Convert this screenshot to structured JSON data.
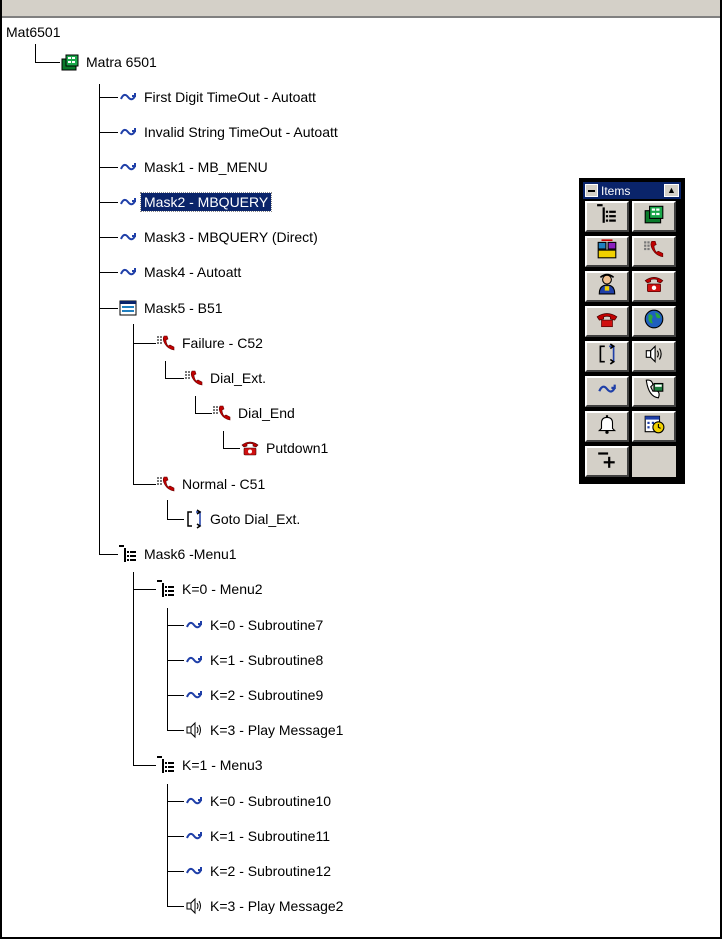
{
  "tree": {
    "root_label": "Mat6501",
    "nodes": [
      {
        "label": "Matra 6501",
        "icon": "matra-switch-icon"
      },
      {
        "label": "First Digit TimeOut - Autoatt",
        "icon": "subroutine-arrow-icon"
      },
      {
        "label": "Invalid String TimeOut - Autoatt",
        "icon": "subroutine-arrow-icon"
      },
      {
        "label": "Mask1 - MB_MENU",
        "icon": "subroutine-arrow-icon"
      },
      {
        "label": "Mask2 - MBQUERY",
        "icon": "subroutine-arrow-icon",
        "selected": true
      },
      {
        "label": "Mask3 - MBQUERY (Direct)",
        "icon": "subroutine-arrow-icon"
      },
      {
        "label": "Mask4 - Autoatt",
        "icon": "subroutine-arrow-icon"
      },
      {
        "label": "Mask5 - B51",
        "icon": "form-window-icon"
      },
      {
        "label": "Failure - C52",
        "icon": "dial-phone-icon"
      },
      {
        "label": "Dial_Ext.",
        "icon": "dial-phone-icon"
      },
      {
        "label": "Dial_End",
        "icon": "dial-phone-icon"
      },
      {
        "label": "Putdown1",
        "icon": "red-telephone-icon"
      },
      {
        "label": "Normal - C51",
        "icon": "dial-phone-icon"
      },
      {
        "label": "Goto Dial_Ext.",
        "icon": "goto-bracket-icon"
      },
      {
        "label": "Mask6 -Menu1",
        "icon": "menu-tree-icon"
      },
      {
        "label": "K=0 - Menu2",
        "icon": "menu-tree-icon"
      },
      {
        "label": "K=0 - Subroutine7",
        "icon": "subroutine-arrow-icon"
      },
      {
        "label": "K=1 - Subroutine8",
        "icon": "subroutine-arrow-icon"
      },
      {
        "label": "K=2 - Subroutine9",
        "icon": "subroutine-arrow-icon"
      },
      {
        "label": "K=3 - Play Message1",
        "icon": "speaker-icon"
      },
      {
        "label": "K=1 - Menu3",
        "icon": "menu-tree-icon"
      },
      {
        "label": "K=0 - Subroutine10",
        "icon": "subroutine-arrow-icon"
      },
      {
        "label": "K=1 - Subroutine11",
        "icon": "subroutine-arrow-icon"
      },
      {
        "label": "K=2 - Subroutine12",
        "icon": "subroutine-arrow-icon"
      },
      {
        "label": "K=3 - Play Message2",
        "icon": "speaker-icon"
      }
    ]
  },
  "palette": {
    "title": "Items",
    "buttons": [
      "menu-tree-icon",
      "matra-switch-icon",
      "transfer-icon",
      "dial-phone-icon",
      "operator-icon",
      "red-telephone-icon",
      "hangup-phone-icon",
      "globe-icon",
      "goto-bracket-icon",
      "speaker-icon",
      "subroutine-arrow-icon",
      "voicemail-icon",
      "bell-icon",
      "schedule-icon",
      "add-item-icon"
    ]
  },
  "colors": {
    "selection": "#0a246a",
    "window_face": "#d4d0c8",
    "arrow_blue": "#1f3fa8",
    "phone_red": "#c00000"
  }
}
